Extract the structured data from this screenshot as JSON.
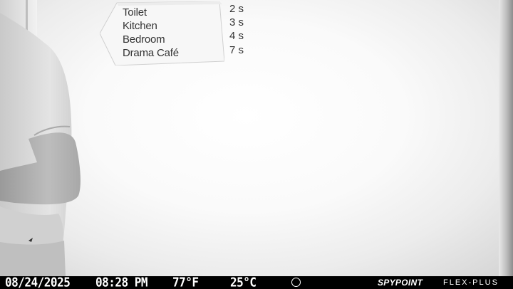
{
  "sign": {
    "rows": [
      {
        "label": "Toilet",
        "time": "2 s"
      },
      {
        "label": "Kitchen",
        "time": "3 s"
      },
      {
        "label": "Bedroom",
        "time": "4 s"
      },
      {
        "label": "Drama Café",
        "time": "7 s"
      }
    ]
  },
  "overlay": {
    "date": "08/24/2025",
    "time": "08:28 PM",
    "temp_f": "77°F",
    "temp_c": "25°C",
    "moon_icon": "moon-phase-icon",
    "brand": "SPYPOINT",
    "model": "FLEX-PLUS"
  }
}
